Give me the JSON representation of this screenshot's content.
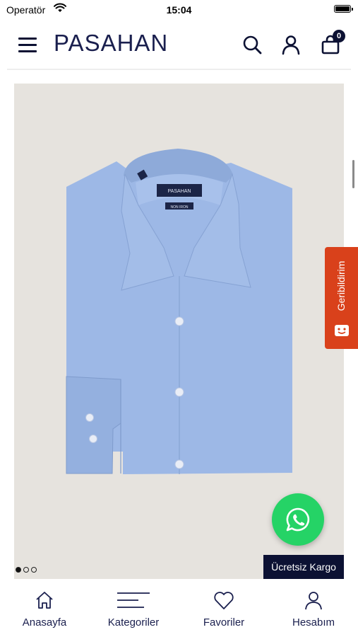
{
  "status_bar": {
    "carrier": "Operatör",
    "time": "15:04"
  },
  "header": {
    "brand": "PASAHAN",
    "cart_count": "0"
  },
  "product": {
    "image_slide_count": 3,
    "active_slide": 1,
    "shirt_tag_label": "PASAHAN",
    "shirt_sublabel": "NON IRON",
    "image_colors": {
      "background": "#e6e3de",
      "shirt": "#9db8e6"
    }
  },
  "free_shipping_label": "Ücretsiz Kargo",
  "feedback_label": "Geribildirim",
  "bottom_nav": {
    "items": [
      {
        "label": "Anasayfa",
        "icon": "home-icon"
      },
      {
        "label": "Kategoriler",
        "icon": "categories-icon"
      },
      {
        "label": "Favoriler",
        "icon": "heart-icon"
      },
      {
        "label": "Hesabım",
        "icon": "user-icon"
      }
    ]
  },
  "colors": {
    "brand_navy": "#0c1133",
    "feedback_orange": "#d9411b",
    "whatsapp_green": "#25d366"
  }
}
